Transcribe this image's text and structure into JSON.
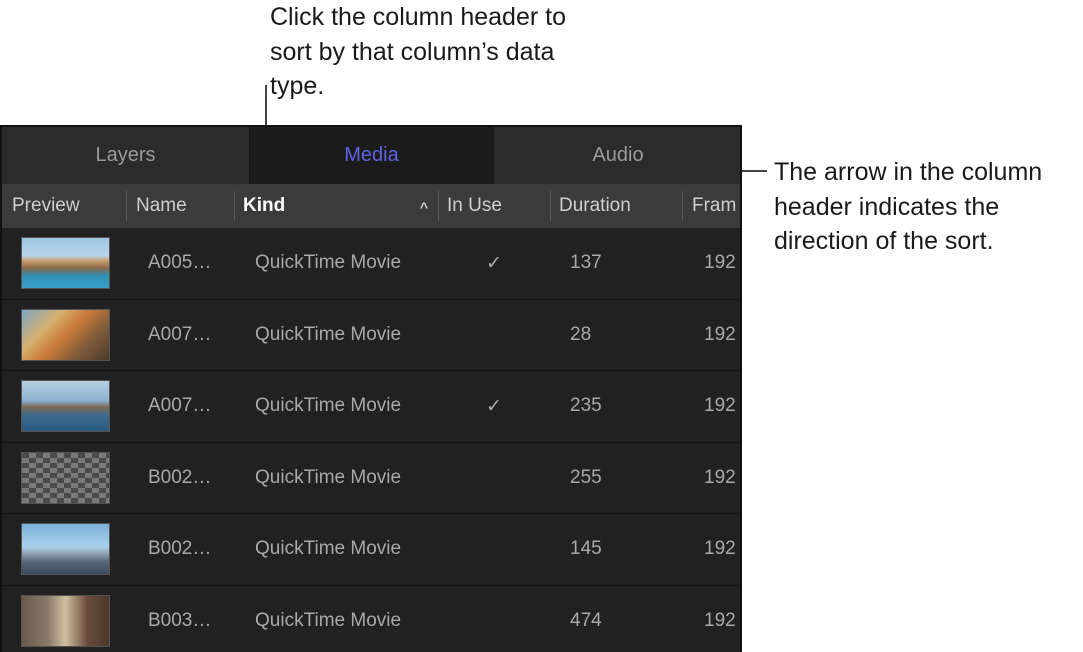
{
  "callouts": {
    "top": "Click the column header to sort by that column’s data type.",
    "right": "The arrow in the column header indicates the direction of the sort."
  },
  "tabs": [
    {
      "label": "Layers",
      "active": false
    },
    {
      "label": "Media",
      "active": true
    },
    {
      "label": "Audio",
      "active": false
    }
  ],
  "columns": {
    "preview": "Preview",
    "name": "Name",
    "kind": "Kind",
    "sort_arrow": "^",
    "in_use": "In Use",
    "duration": "Duration",
    "frame": "Fram"
  },
  "rows": [
    {
      "name": "A005…",
      "kind": "QuickTime Movie",
      "in_use": "✓",
      "duration": "137",
      "frame": "192"
    },
    {
      "name": "A007…",
      "kind": "QuickTime Movie",
      "in_use": "",
      "duration": "28",
      "frame": "192"
    },
    {
      "name": "A007…",
      "kind": "QuickTime Movie",
      "in_use": "✓",
      "duration": "235",
      "frame": "192"
    },
    {
      "name": "B002…",
      "kind": "QuickTime Movie",
      "in_use": "",
      "duration": "255",
      "frame": "192"
    },
    {
      "name": "B002…",
      "kind": "QuickTime Movie",
      "in_use": "",
      "duration": "145",
      "frame": "192"
    },
    {
      "name": "B003…",
      "kind": "QuickTime Movie",
      "in_use": "",
      "duration": "474",
      "frame": "192"
    }
  ],
  "colors": {
    "active_tab": "#5d63e6",
    "panel_bg": "#1f1f1f",
    "header_bg": "#3b3b3b"
  }
}
